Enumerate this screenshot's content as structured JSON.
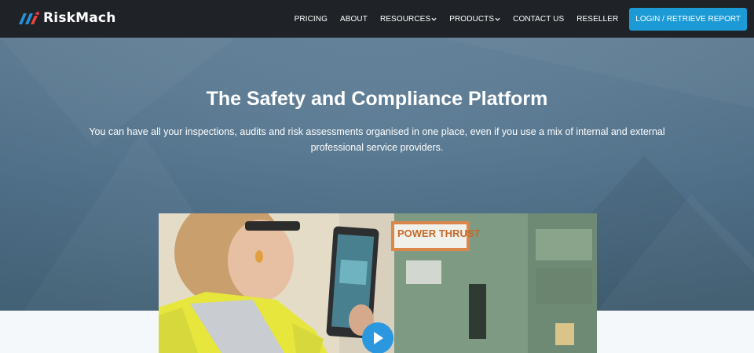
{
  "brand": {
    "name": "RiskMach",
    "logo_icon": "riskmach-logo-mark"
  },
  "nav": {
    "items": [
      {
        "label": "PRICING",
        "dropdown": false
      },
      {
        "label": "ABOUT",
        "dropdown": false
      },
      {
        "label": "RESOURCES",
        "dropdown": true
      },
      {
        "label": "PRODUCTS",
        "dropdown": true
      },
      {
        "label": "CONTACT US",
        "dropdown": false
      },
      {
        "label": "RESELLER",
        "dropdown": false
      }
    ],
    "login_label": "LOGIN / RETRIEVE REPORT"
  },
  "hero": {
    "title": "The Safety and Compliance Platform",
    "subtitle": "You can have all your inspections, audits and risk assessments organised in one place, even if you use a mix of internal and external professional service providers."
  },
  "video": {
    "machine_label": "POWER THRUST",
    "play_icon": "play-icon"
  },
  "colors": {
    "header_bg": "#1f2327",
    "accent": "#1b9ad6",
    "hero_bg": "#4f718c",
    "logo_blue": "#2a8fd6",
    "logo_red": "#e8443a"
  }
}
